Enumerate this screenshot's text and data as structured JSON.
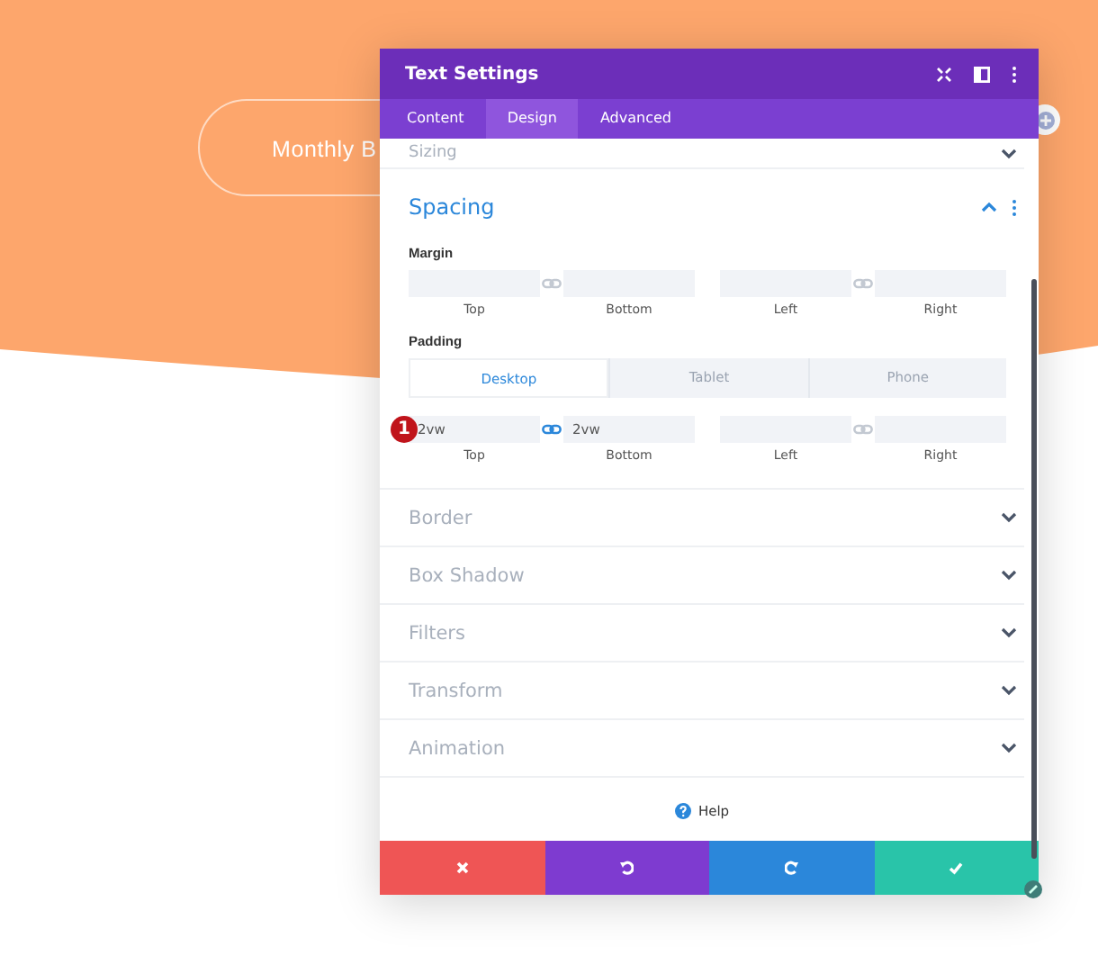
{
  "background_button": {
    "label": "Monthly B"
  },
  "window": {
    "title": "Text Settings"
  },
  "tabs": [
    {
      "label": "Content",
      "selected": false
    },
    {
      "label": "Design",
      "selected": true
    },
    {
      "label": "Advanced",
      "selected": false
    }
  ],
  "sections": [
    {
      "title": "Sizing",
      "expanded": false
    },
    {
      "title": "Spacing",
      "expanded": true,
      "groups": [
        {
          "label": "Margin",
          "pairs": [
            {
              "linked": false,
              "fields": [
                {
                  "label": "Top"
                },
                {
                  "label": "Bottom"
                }
              ]
            },
            {
              "linked": false,
              "fields": [
                {
                  "label": "Left"
                },
                {
                  "label": "Right"
                }
              ]
            }
          ]
        },
        {
          "label": "Padding",
          "devices": [
            {
              "label": "Desktop",
              "selected": true
            },
            {
              "label": "Tablet",
              "selected": false
            },
            {
              "label": "Phone",
              "selected": false
            }
          ],
          "step_badge": "1",
          "pairs": [
            {
              "linked": true,
              "fields": [
                {
                  "label": "Top",
                  "value": "2vw"
                },
                {
                  "label": "Bottom",
                  "value": "2vw"
                }
              ]
            },
            {
              "linked": false,
              "fields": [
                {
                  "label": "Left"
                },
                {
                  "label": "Right"
                }
              ]
            }
          ]
        }
      ]
    },
    {
      "title": "Border",
      "expanded": false
    },
    {
      "title": "Box Shadow",
      "expanded": false
    },
    {
      "title": "Filters",
      "expanded": false
    },
    {
      "title": "Transform",
      "expanded": false
    },
    {
      "title": "Animation",
      "expanded": false
    }
  ],
  "help": {
    "label": "Help"
  },
  "actions": [
    {
      "kind": "cancel",
      "color": "#ef5555"
    },
    {
      "kind": "undo",
      "color": "#7e3bd0"
    },
    {
      "kind": "redo",
      "color": "#2b87da"
    },
    {
      "kind": "save",
      "color": "#29c4a9"
    }
  ]
}
